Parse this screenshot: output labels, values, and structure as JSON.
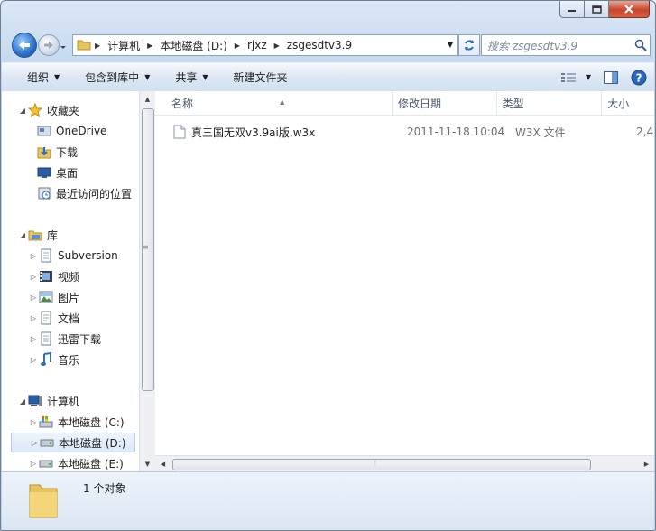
{
  "window": {
    "controls": [
      "minimize",
      "maximize",
      "close"
    ]
  },
  "nav": {
    "path": [
      "计算机",
      "本地磁盘 (D:)",
      "rjxz",
      "zsgesdtv3.9"
    ],
    "search_placeholder": "搜索 zsgesdtv3.9"
  },
  "toolbar": {
    "organize": "组织",
    "include_library": "包含到库中",
    "share": "共享",
    "new_folder": "新建文件夹"
  },
  "sidebar": {
    "favorites": "收藏夹",
    "onedrive": "OneDrive",
    "downloads": "下载",
    "desktop": "桌面",
    "recent": "最近访问的位置",
    "libraries": "库",
    "subversion": "Subversion",
    "videos": "视频",
    "pictures": "图片",
    "documents": "文档",
    "thunder": "迅雷下载",
    "music": "音乐",
    "computer": "计算机",
    "drive_c": "本地磁盘 (C:)",
    "drive_d": "本地磁盘 (D:)",
    "drive_e": "本地磁盘 (E:)"
  },
  "columns": {
    "name": "名称",
    "modified": "修改日期",
    "type": "类型",
    "size": "大小"
  },
  "files": [
    {
      "name": "真三国无双v3.9ai版.w3x",
      "modified": "2011-11-18 10:04",
      "type": "W3X 文件",
      "size": "2,4"
    }
  ],
  "status": {
    "count": "1 个对象"
  }
}
